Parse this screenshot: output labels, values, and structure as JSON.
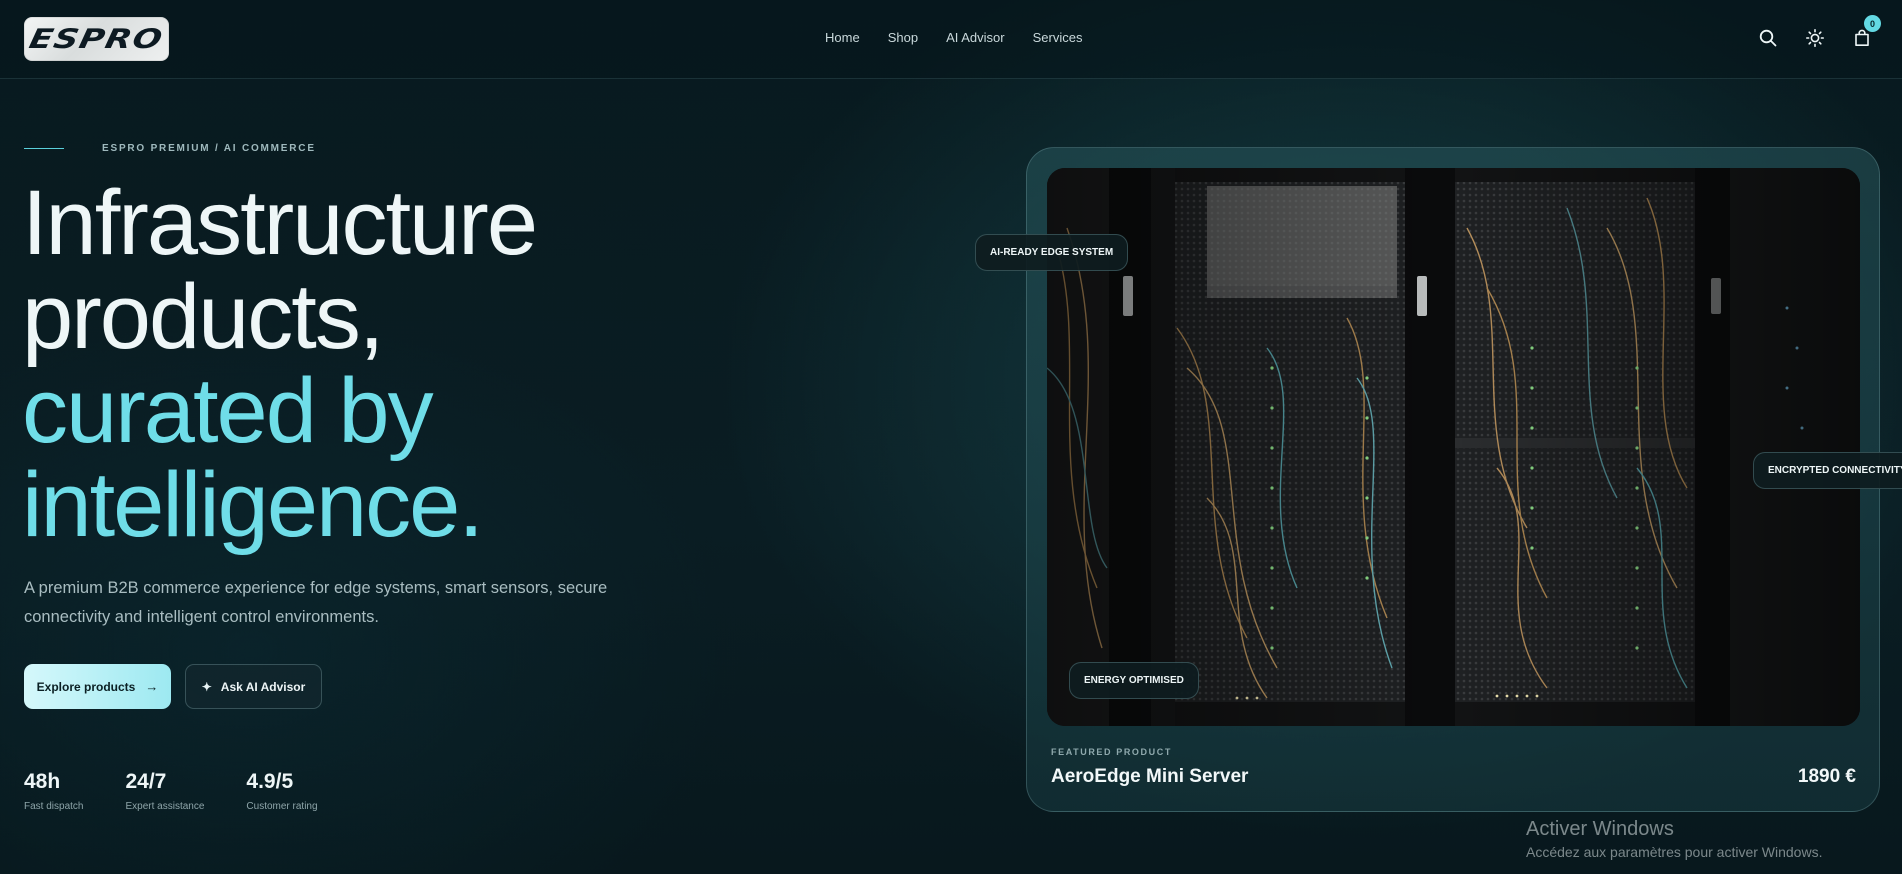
{
  "brand": {
    "logo_text": "ESPRO"
  },
  "nav": {
    "items": [
      {
        "label": "Home"
      },
      {
        "label": "Shop"
      },
      {
        "label": "AI Advisor"
      },
      {
        "label": "Services"
      }
    ]
  },
  "header_icons": {
    "search": "search-icon",
    "theme": "sun-icon",
    "cart": "shopping-bag-icon",
    "cart_count": "0"
  },
  "hero": {
    "eyebrow": "ESPRO PREMIUM / AI COMMERCE",
    "headline_line1": "Infrastructure",
    "headline_line2": "products,",
    "headline_line3": "curated by",
    "headline_line4": "intelligence.",
    "subtext": "A premium B2B commerce experience for edge systems, smart sensors, secure connectivity and intelligent control environments.",
    "primary_cta": "Explore products",
    "secondary_cta": "Ask AI Advisor",
    "stats": [
      {
        "value": "48h",
        "label": "Fast dispatch"
      },
      {
        "value": "24/7",
        "label": "Expert assistance"
      },
      {
        "value": "4.9/5",
        "label": "Customer rating"
      }
    ]
  },
  "featured": {
    "badges": {
      "top_left": "AI-READY EDGE SYSTEM",
      "right": "ENCRYPTED CONNECTIVITY",
      "bottom_left": "ENERGY OPTIMISED"
    },
    "eyebrow": "FEATURED PRODUCT",
    "product_name": "AeroEdge Mini Server",
    "price": "1890 €"
  },
  "watermark": {
    "title": "Activer Windows",
    "subtitle": "Accédez aux paramètres pour activer Windows."
  },
  "colors": {
    "accent": "#6fdde8",
    "background": "#0a1d23",
    "card": "#1d4a50"
  }
}
